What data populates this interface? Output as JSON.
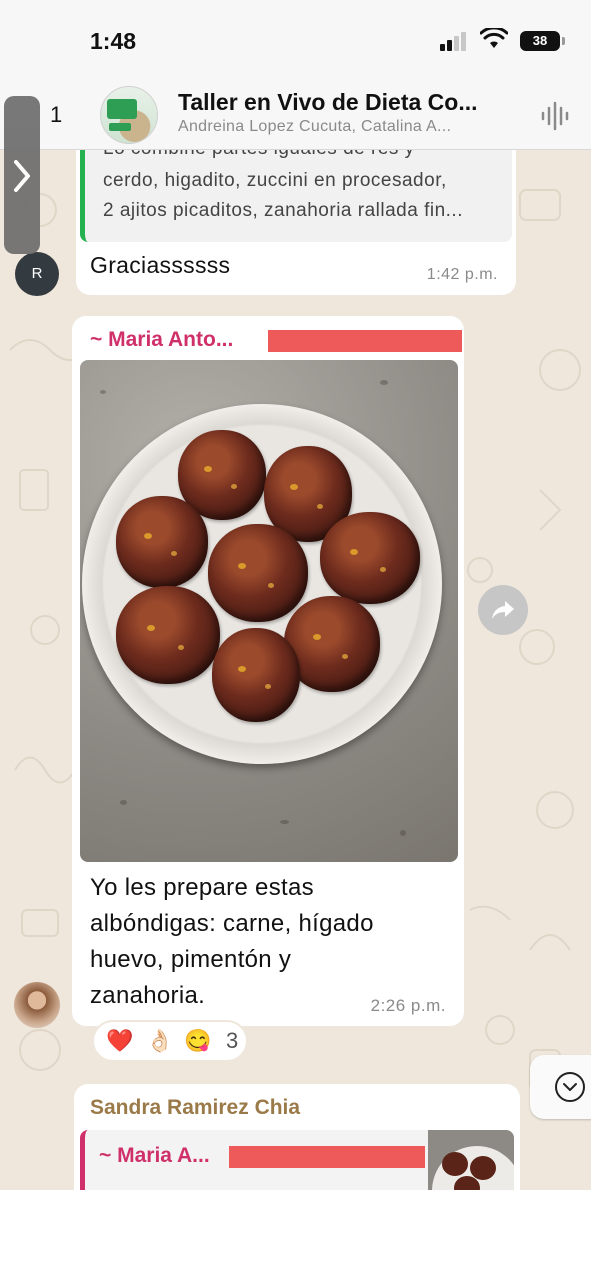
{
  "status_bar": {
    "time": "1:48",
    "battery": "38"
  },
  "header": {
    "back_count": "1",
    "title": "Taller en Vivo de Dieta Co...",
    "subtitle": "Andreina Lopez Cucuta, Catalina A..."
  },
  "messages": {
    "quoted": {
      "lines": [
        "Lo combiné partes iguales de res y",
        "cerdo, higadito, zuccini en procesador,",
        "2 ajitos picaditos, zanahoria rallada fin..."
      ],
      "text": "Graciassssss",
      "time": "1:42 p.m.",
      "avatar_initial": "R"
    },
    "photo_message": {
      "sender": "~ Maria Anto...",
      "caption_lines": [
        "Yo les prepare estas",
        "albóndigas: carne, hígado",
        "huevo, pimentón y",
        "zanahoria."
      ],
      "time": "2:26 p.m.",
      "reactions": [
        "❤️",
        "👌🏻",
        "😋"
      ],
      "reaction_count": "3"
    },
    "next_message": {
      "sender": "Sandra Ramirez Chia",
      "reply_sender": "~ Maria A..."
    }
  },
  "icons": {
    "back": "chevron-right-icon",
    "voice": "audio-waveform-icon",
    "forward": "forward-arrow-icon",
    "scroll": "chevron-down-icon"
  },
  "colors": {
    "sender_pink": "#d0306a",
    "sender_gold": "#9b7a49",
    "quote_bar_green": "#25b14f",
    "redaction_red": "#ee5a5a",
    "wallpaper": "#efe7dc"
  }
}
